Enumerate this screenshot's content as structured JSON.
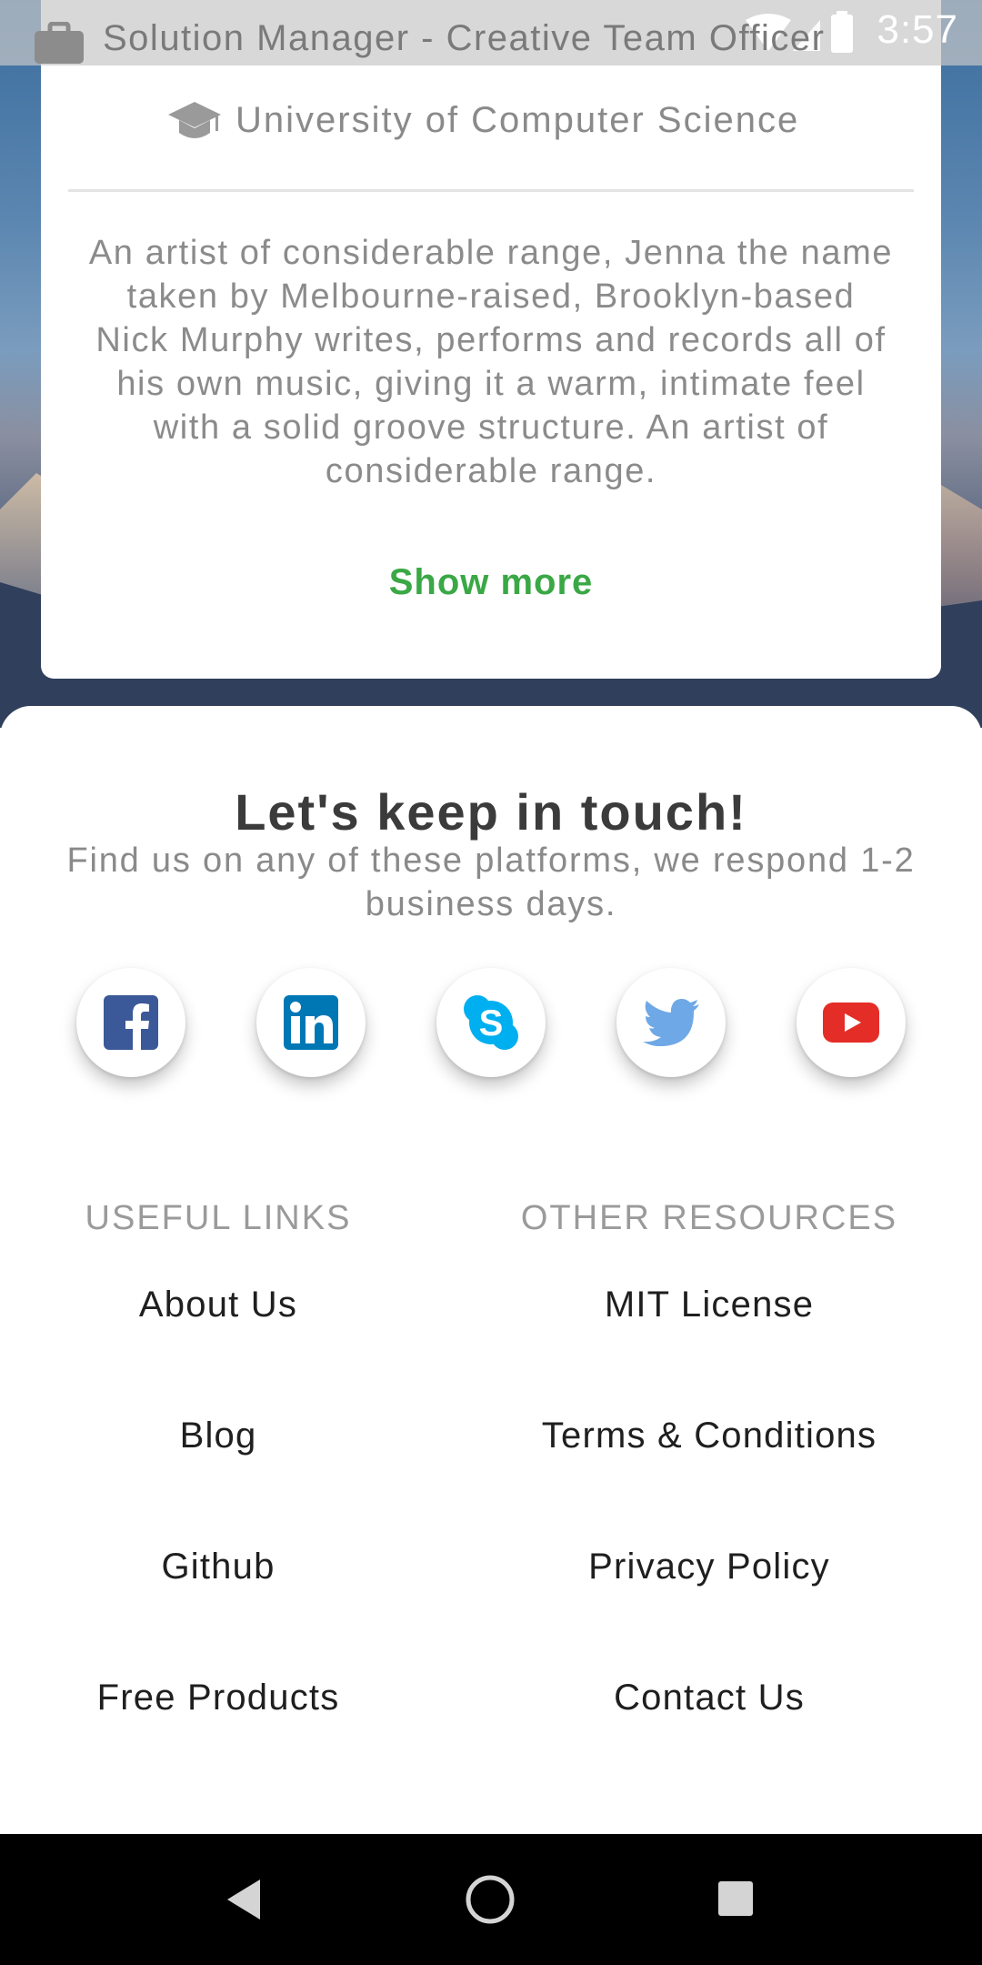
{
  "status_bar": {
    "time": "3:57"
  },
  "profile": {
    "job_title": "Solution Manager - Creative Team Officer",
    "education": "University of Computer Science",
    "bio": "An artist of considerable range, Jenna the name taken by Melbourne-raised, Brooklyn-based Nick Murphy writes, performs and records all of his own music, giving it a warm, intimate feel with a solid groove structure. An artist of considerable range.",
    "show_more_label": "Show more",
    "icons": {
      "job": "briefcase-icon",
      "education": "graduation-cap-icon"
    }
  },
  "contact": {
    "title": "Let's keep in touch!",
    "subtitle": "Find us on any of these platforms, we respond 1-2 business days.",
    "socials": [
      {
        "icon": "facebook-icon",
        "color": "#3b5998"
      },
      {
        "icon": "linkedin-icon",
        "color": "#0077b5"
      },
      {
        "icon": "skype-icon",
        "color": "#00aff0"
      },
      {
        "icon": "twitter-icon",
        "color": "#55acee"
      },
      {
        "icon": "youtube-icon",
        "color": "#e52d27"
      }
    ]
  },
  "footer": {
    "useful_links": {
      "header": "USEFUL LINKS",
      "items": [
        "About Us",
        "Blog",
        "Github",
        "Free Products"
      ]
    },
    "other_resources": {
      "header": "OTHER RESOURCES",
      "items": [
        "MIT License",
        "Terms & Conditions",
        "Privacy Policy",
        "Contact Us"
      ]
    }
  },
  "colors": {
    "accent_green": "#3aa845",
    "text_dark": "#3b3b3b",
    "text_muted": "#8a8a8a"
  },
  "nav_bar": {
    "icons": [
      "back-icon",
      "home-icon",
      "recents-icon"
    ]
  }
}
